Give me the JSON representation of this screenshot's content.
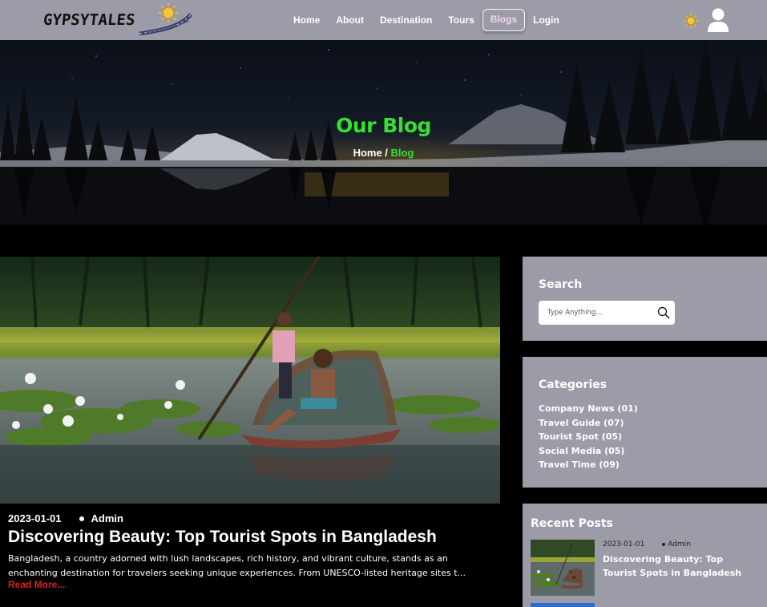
{
  "brand": {
    "name": "GYPSYTALES"
  },
  "nav": {
    "items": [
      {
        "label": "Home"
      },
      {
        "label": "About"
      },
      {
        "label": "Destination"
      },
      {
        "label": "Tours"
      },
      {
        "label": "Blogs"
      },
      {
        "label": "Login"
      }
    ],
    "active": "Blogs",
    "theme_icon": "sun-icon",
    "user_icon": "user-icon"
  },
  "hero": {
    "title": "Our Blog",
    "breadcrumb": {
      "home": "Home",
      "separator": " / ",
      "current": "Blog"
    }
  },
  "post": {
    "date": "2023-01-01",
    "author": "Admin",
    "title": "Discovering Beauty: Top Tourist Spots in Bangladesh",
    "excerpt": "Bangladesh, a country adorned with lush landscapes, rich history, and vibrant culture, stands as an enchanting destination for travelers seeking unique experiences. From UNESCO-listed heritage sites t...",
    "read_more": "Read More..."
  },
  "sidebar": {
    "search": {
      "title": "Search",
      "placeholder": "Type Anything..."
    },
    "categories": {
      "title": "Categories",
      "items": [
        "Company News (01)",
        "Travel Guide (07)",
        "Tourist Spot (05)",
        "Social Media (05)",
        "Travel Time (09)"
      ]
    },
    "recent": {
      "title": "Recent Posts",
      "posts": [
        {
          "date": "2023-01-01",
          "author": "Admin",
          "title": "Discovering Beauty: Top Tourist Spots in Bangladesh"
        }
      ]
    }
  },
  "colors": {
    "nav_bg": "#9c9ba8",
    "accent_green": "#35e02f",
    "read_more_red": "#e0201d",
    "page_bg": "#000000"
  }
}
